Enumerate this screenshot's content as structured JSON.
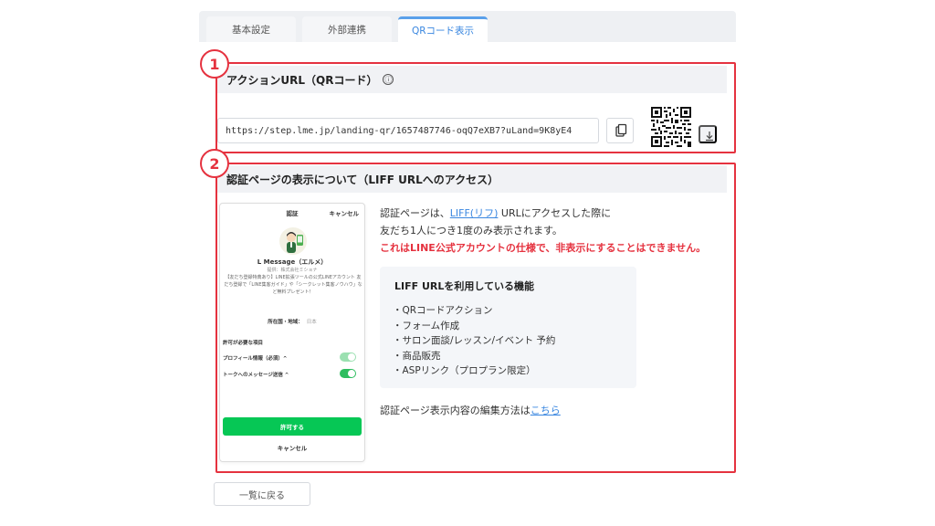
{
  "tabs": [
    {
      "label": "基本設定",
      "active": false
    },
    {
      "label": "外部連携",
      "active": false
    },
    {
      "label": "QRコード表示",
      "active": true
    }
  ],
  "annotations": {
    "one": "1",
    "two": "2"
  },
  "section1": {
    "title": "アクションURL（QRコード）",
    "info_icon": "ⓘ",
    "url_value": "https://step.lme.jp/landing-qr/1657487746-oqQ7eXB7?uLand=9K8yE4"
  },
  "section2": {
    "title": "認証ページの表示について（LIFF URLへのアクセス）",
    "description": {
      "line1_prefix": "認証ページは、",
      "line1_link": "LIFF(リフ)",
      "line1_suffix": " URLにアクセスした際に",
      "line2": "友だち1人につき1度のみ表示されます。",
      "line3_warning": "これはLINE公式アカウントの仕様で、非表示にすることはできません。"
    },
    "features": {
      "title": "LIFF URLを利用している機能",
      "items": [
        "・QRコードアクション",
        "・フォーム作成",
        "・サロン面談/レッスン/イベント 予約",
        "・商品販売",
        "・ASPリンク（プロプラン限定）"
      ]
    },
    "edit_prefix": "認証ページ表示内容の編集方法は",
    "edit_link": "こちら"
  },
  "phone": {
    "title": "認証",
    "cancel_top": "キャンセル",
    "name": "L Message（エルメ）",
    "provider": "提供：株式会社ミショナ",
    "description": "【友だち登録特典あり】LINE拡張ツールの公式LINEアカウント 友だち登録で「LINE集客ガイド」や「シークレット集客ノウハウ」など無料プレゼント！",
    "country_label": "所在国・地域：",
    "country_value": "日本",
    "permissions_label": "許可が必要な項目",
    "permission_profile": "プロフィール情報（必須）^",
    "permission_talk": "トークへのメッセージ送信 ^",
    "allow_button": "許可する",
    "cancel_bottom": "キャンセル"
  },
  "back_button": "一覧に戻る",
  "colors": {
    "accent_blue": "#3a87e0",
    "annotation_red": "#e5323f",
    "line_green": "#06c755"
  }
}
